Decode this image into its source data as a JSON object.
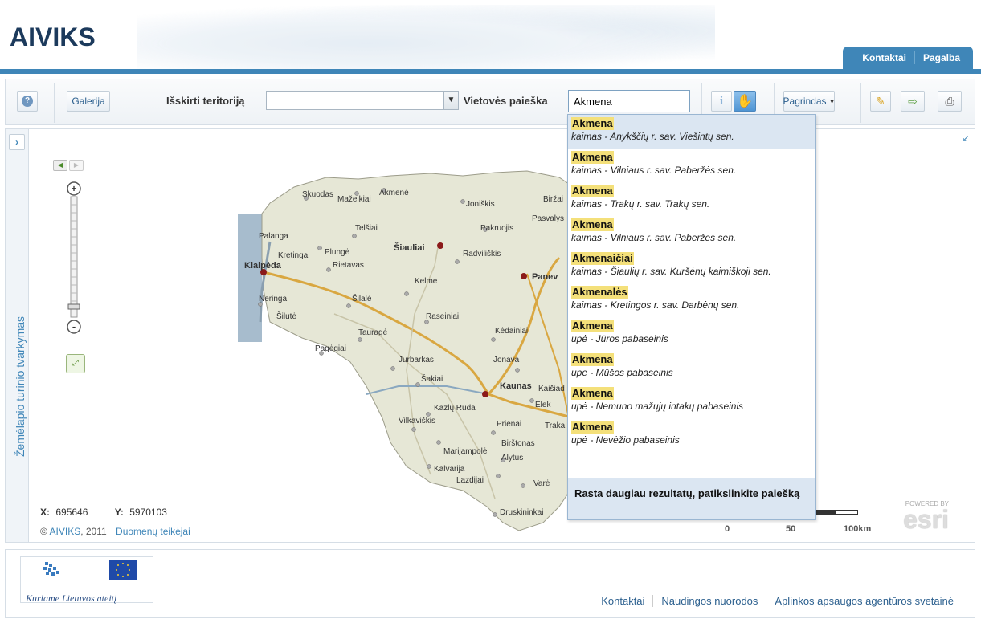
{
  "header": {
    "logo": "AIVIKS",
    "tabs": [
      {
        "label": "Kontaktai"
      },
      {
        "label": "Pagalba"
      }
    ]
  },
  "toolbar": {
    "help_label": "?",
    "gallery_label": "Galerija",
    "territory_label": "Išskirti teritoriją",
    "territory_value": "",
    "search_label": "Vietovės paieška",
    "search_value": "Akmena",
    "info_label": "i",
    "basemap_label": "Pagrindas"
  },
  "sidepanel": {
    "expand_label": "›",
    "title": "Žemėlapio turinio tvarkymas"
  },
  "map": {
    "cities": [
      {
        "name": "Skuodas"
      },
      {
        "name": "Mažeikiai"
      },
      {
        "name": "Akmenė"
      },
      {
        "name": "Joniškis"
      },
      {
        "name": "Biržai"
      },
      {
        "name": "Pasvalys"
      },
      {
        "name": "Palanga"
      },
      {
        "name": "Telšiai"
      },
      {
        "name": "Pakruojis"
      },
      {
        "name": "Kretinga"
      },
      {
        "name": "Plungė"
      },
      {
        "name": "Šiauliai"
      },
      {
        "name": "Radviliškis"
      },
      {
        "name": "Klaipėda"
      },
      {
        "name": "Rietavas"
      },
      {
        "name": "Kelmė"
      },
      {
        "name": "Panevėžys"
      },
      {
        "name": "Neringa"
      },
      {
        "name": "Šilalė"
      },
      {
        "name": "Šilutė"
      },
      {
        "name": "Raseiniai"
      },
      {
        "name": "Tauragė"
      },
      {
        "name": "Kėdainiai"
      },
      {
        "name": "Pagėgiai"
      },
      {
        "name": "Jurbarkas"
      },
      {
        "name": "Jonava"
      },
      {
        "name": "Šakiai"
      },
      {
        "name": "Kaunas"
      },
      {
        "name": "Kaišiadorys"
      },
      {
        "name": "Kazlų Rūda"
      },
      {
        "name": "Elektrėnai"
      },
      {
        "name": "Vilkaviškis"
      },
      {
        "name": "Prienai"
      },
      {
        "name": "Trakai"
      },
      {
        "name": "Birštonas"
      },
      {
        "name": "Marijampolė"
      },
      {
        "name": "Alytus"
      },
      {
        "name": "Kalvarija"
      },
      {
        "name": "Lazdijai"
      },
      {
        "name": "Varėna"
      },
      {
        "name": "Druskininkai"
      }
    ],
    "coords": {
      "x_label": "X:",
      "x_value": "695646",
      "y_label": "Y:",
      "y_value": "5970103"
    },
    "copyright": {
      "prefix": "© ",
      "owner": "AIVIKS",
      "year": ", 2011",
      "providers": "Duomenų teikėjai"
    },
    "scale": {
      "t0": "0",
      "t1": "50",
      "t2": "100km"
    },
    "esri": {
      "powered": "POWERED BY",
      "brand": "esri"
    }
  },
  "suggestions": [
    {
      "name": "Akmena",
      "desc": "kaimas - Anykščių r. sav. Viešintų sen."
    },
    {
      "name": "Akmena",
      "desc": "kaimas - Vilniaus r. sav. Paberžės sen."
    },
    {
      "name": "Akmena",
      "desc": "kaimas - Trakų r. sav. Trakų sen."
    },
    {
      "name": "Akmena",
      "desc": "kaimas - Vilniaus r. sav. Paberžės sen."
    },
    {
      "name": "Akmenaičiai",
      "desc": "kaimas - Šiaulių r. sav. Kuršėnų kaimiškoji sen."
    },
    {
      "name": "Akmenalės",
      "desc": "kaimas - Kretingos r. sav. Darbėnų sen."
    },
    {
      "name": "Akmena",
      "desc": "upė - Jūros pabaseinis"
    },
    {
      "name": "Akmena",
      "desc": "upė - Mūšos pabaseinis"
    },
    {
      "name": "Akmena",
      "desc": "upė - Nemuno mažųjų intakų pabaseinis"
    },
    {
      "name": "Akmena",
      "desc": "upė - Nevėžio pabaseinis"
    }
  ],
  "suggest_footer": "Rasta daugiau rezultatų, patikslinkite paiešką",
  "footer": {
    "slogan": "Kuriame Lietuvos ateitį",
    "links": [
      {
        "label": "Kontaktai"
      },
      {
        "label": "Naudingos nuorodos"
      },
      {
        "label": "Aplinkos apsaugos agentūros svetainė"
      }
    ]
  }
}
